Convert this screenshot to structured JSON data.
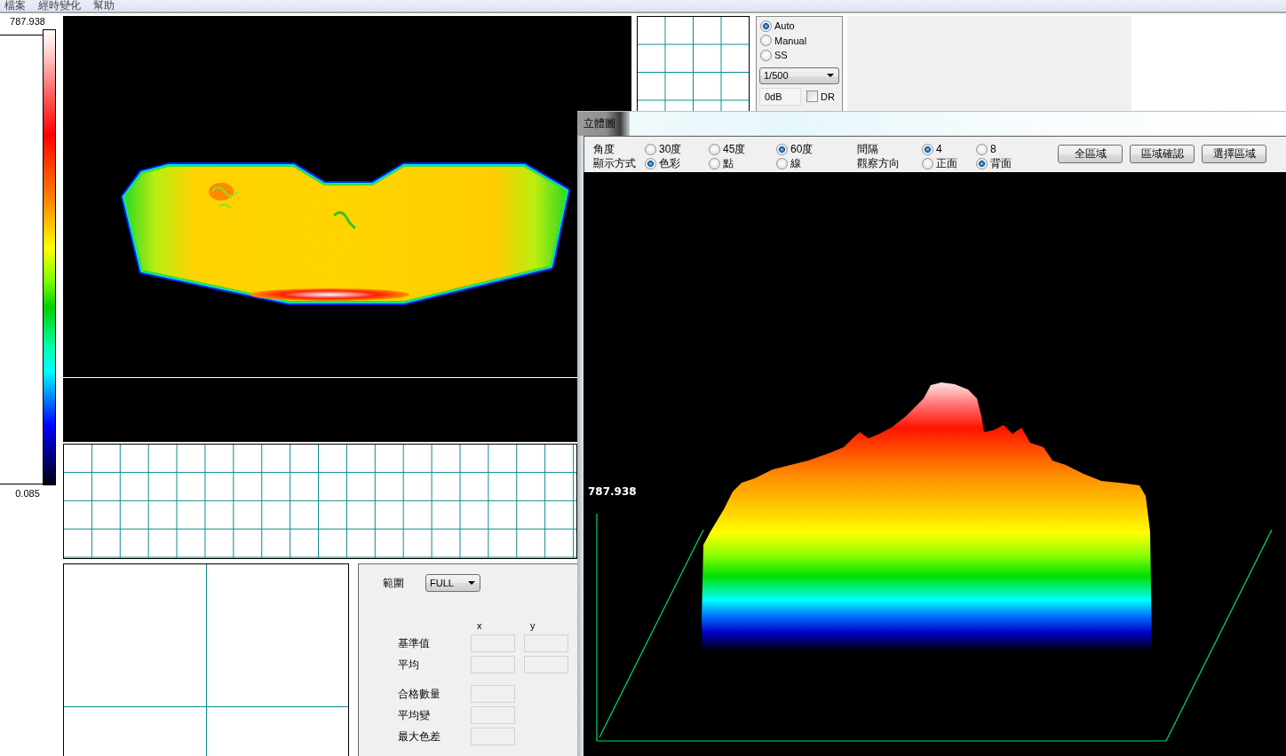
{
  "menu_bar": {
    "items": [
      "檔案",
      "經時變化",
      "幫助"
    ]
  },
  "color_scale": {
    "max_label": "787.938",
    "min_label": "0.085"
  },
  "exposure": {
    "modes": [
      {
        "label": "Auto",
        "selected": true
      },
      {
        "label": "Manual",
        "selected": false
      },
      {
        "label": "SS",
        "selected": false
      }
    ],
    "shutter": {
      "value": "1/500"
    },
    "gain": {
      "value": "0dB"
    },
    "dr": {
      "label": "DR",
      "checked": false
    }
  },
  "range_panel": {
    "range": {
      "label": "範圍",
      "value": "FULL"
    },
    "columns": [
      "x",
      "y"
    ],
    "rows": [
      {
        "label": "基準值",
        "kind": "pair"
      },
      {
        "label": "平均",
        "kind": "pair"
      },
      {
        "label": "合格數量",
        "kind": "single"
      },
      {
        "label": "平均變",
        "kind": "single"
      },
      {
        "label": "最大色差",
        "kind": "single"
      }
    ]
  },
  "window_3d": {
    "title": "立體圖",
    "option_groups": [
      {
        "label": "角度",
        "options": [
          {
            "label": "30度",
            "selected": false
          },
          {
            "label": "45度",
            "selected": false
          },
          {
            "label": "60度",
            "selected": true
          }
        ]
      },
      {
        "label": "顯示方式",
        "options": [
          {
            "label": "色彩",
            "selected": true
          },
          {
            "label": "點",
            "selected": false
          },
          {
            "label": "線",
            "selected": false
          }
        ]
      },
      {
        "label": "間隔",
        "options": [
          {
            "label": "4",
            "selected": true
          },
          {
            "label": "8",
            "selected": false
          }
        ]
      },
      {
        "label": "觀察方向",
        "options": [
          {
            "label": "正面",
            "selected": false
          },
          {
            "label": "背面",
            "selected": true
          }
        ]
      }
    ],
    "buttons": [
      "全區域",
      "區域確認",
      "選擇區域"
    ],
    "plot": {
      "max_label": "787.938"
    }
  }
}
